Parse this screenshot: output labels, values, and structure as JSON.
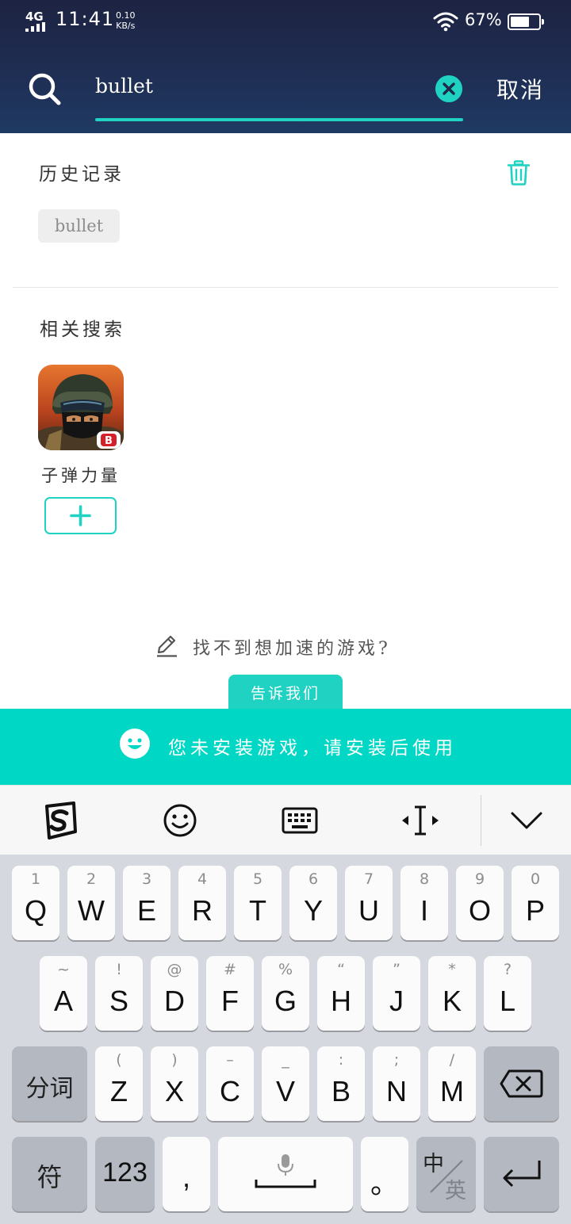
{
  "status_bar": {
    "network": "4G",
    "time": "11:41",
    "speed_value": "0.10",
    "speed_unit": "KB/s",
    "battery_percent": "67%",
    "battery_level": 0.67
  },
  "search": {
    "query": "bullet",
    "cancel_label": "取消",
    "accent_color": "#1fd2c1"
  },
  "history": {
    "title": "历史记录",
    "items": [
      "bullet"
    ]
  },
  "related": {
    "title": "相关搜索",
    "games": [
      {
        "name": "子弹力量"
      }
    ]
  },
  "feedback": {
    "prompt": "找不到想加速的游戏?",
    "button": "告诉我们"
  },
  "banner": {
    "message": "您未安装游戏，请安装后使用",
    "color": "#00d7c4"
  },
  "keyboard": {
    "toolbar_icons": [
      "sogou-icon",
      "emoji-icon",
      "keyboard-icon",
      "cursor-move-icon",
      "collapse-icon"
    ],
    "row1": [
      {
        "hint": "1",
        "key": "Q"
      },
      {
        "hint": "2",
        "key": "W"
      },
      {
        "hint": "3",
        "key": "E"
      },
      {
        "hint": "4",
        "key": "R"
      },
      {
        "hint": "5",
        "key": "T"
      },
      {
        "hint": "6",
        "key": "Y"
      },
      {
        "hint": "7",
        "key": "U"
      },
      {
        "hint": "8",
        "key": "I"
      },
      {
        "hint": "9",
        "key": "O"
      },
      {
        "hint": "0",
        "key": "P"
      }
    ],
    "row2": [
      {
        "hint": "~",
        "key": "A"
      },
      {
        "hint": "!",
        "key": "S"
      },
      {
        "hint": "@",
        "key": "D"
      },
      {
        "hint": "#",
        "key": "F"
      },
      {
        "hint": "%",
        "key": "G"
      },
      {
        "hint": "“",
        "key": "H"
      },
      {
        "hint": "”",
        "key": "J"
      },
      {
        "hint": "*",
        "key": "K"
      },
      {
        "hint": "?",
        "key": "L"
      }
    ],
    "row3": [
      {
        "hint": "(",
        "key": "Z"
      },
      {
        "hint": ")",
        "key": "X"
      },
      {
        "hint": "–",
        "key": "C"
      },
      {
        "hint": "_",
        "key": "V"
      },
      {
        "hint": ":",
        "key": "B"
      },
      {
        "hint": ";",
        "key": "N"
      },
      {
        "hint": "/",
        "key": "M"
      }
    ],
    "segment_label": "分词",
    "symbol_label": "符",
    "number_label": "123",
    "comma_label": ",",
    "period_label": "。",
    "lang_cn": "中",
    "lang_en": "英"
  }
}
